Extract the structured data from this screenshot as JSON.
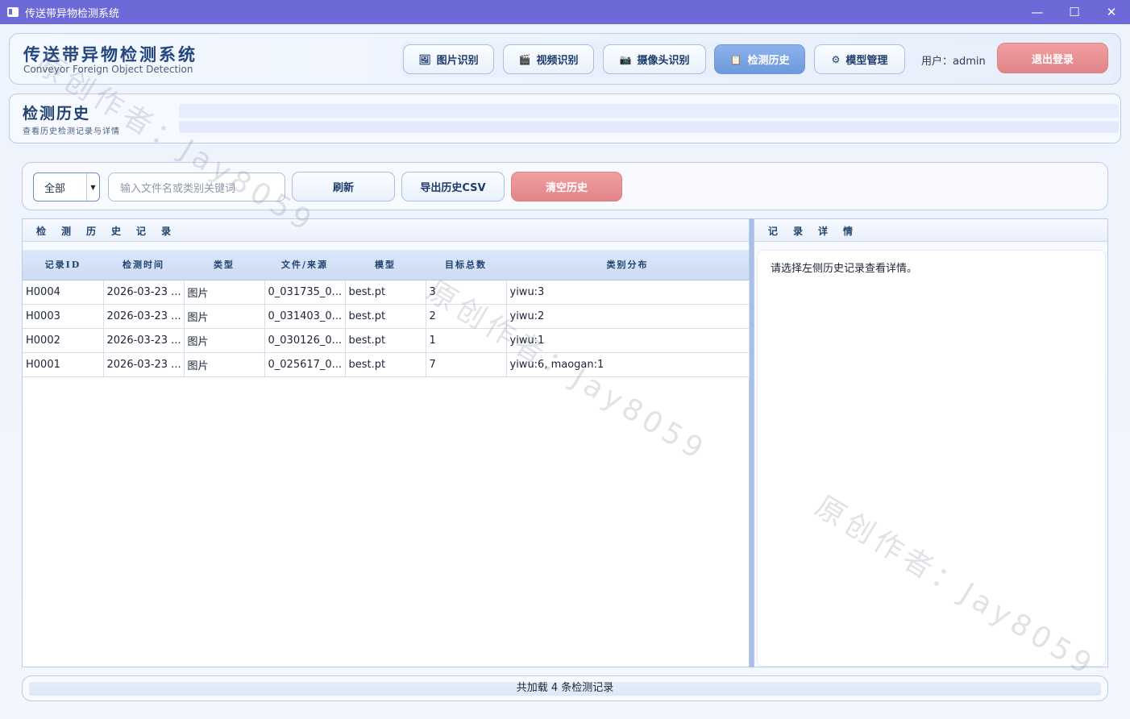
{
  "window": {
    "title": "传送带异物检测系统",
    "minimize": "—",
    "maximize": "☐",
    "close": "✕"
  },
  "header": {
    "title": "传送带异物检测系统",
    "subtitle": "Conveyor Foreign Object Detection",
    "nav": [
      {
        "label": "图片识别",
        "icon": "image-icon",
        "glyph": "🖼"
      },
      {
        "label": "视频识别",
        "icon": "film-icon",
        "glyph": "🎬"
      },
      {
        "label": "摄像头识别",
        "icon": "camera-icon",
        "glyph": "📷"
      },
      {
        "label": "检测历史",
        "icon": "history-icon",
        "glyph": "📋",
        "active": true
      },
      {
        "label": "模型管理",
        "icon": "gear-icon",
        "glyph": "⚙"
      }
    ],
    "user_label": "用户：admin",
    "logout_label": "退出登录"
  },
  "page": {
    "title": "检测历史",
    "subtitle": "查看历史检测记录与详情"
  },
  "toolbar": {
    "filter_value": "全部",
    "search_placeholder": "输入文件名或类别关键词",
    "refresh_label": "刷新",
    "export_label": "导出历史CSV",
    "clear_label": "清空历史"
  },
  "history": {
    "panel_title": "检测历史记录",
    "columns": [
      "记录ID",
      "检测时间",
      "类型",
      "文件/来源",
      "模型",
      "目标总数",
      "类别分布"
    ],
    "rows": [
      [
        "H0004",
        "2026-03-23 ...",
        "图片",
        "0_031735_0...",
        "best.pt",
        "3",
        "yiwu:3"
      ],
      [
        "H0003",
        "2026-03-23 ...",
        "图片",
        "0_031403_0...",
        "best.pt",
        "2",
        "yiwu:2"
      ],
      [
        "H0002",
        "2026-03-23 ...",
        "图片",
        "0_030126_0...",
        "best.pt",
        "1",
        "yiwu:1"
      ],
      [
        "H0001",
        "2026-03-23 ...",
        "图片",
        "0_025617_0...",
        "best.pt",
        "7",
        "yiwu:6, maogan:1"
      ]
    ]
  },
  "detail": {
    "panel_title": "记录详情",
    "placeholder": "请选择左侧历史记录查看详情。"
  },
  "status": {
    "text": "共加载 4 条检测记录"
  },
  "watermark": {
    "text": "原创作者：Jay8059"
  },
  "colors": {
    "accent": "#6c6ad6",
    "active_nav": "#7aa2e0",
    "danger": "#e6898c"
  }
}
